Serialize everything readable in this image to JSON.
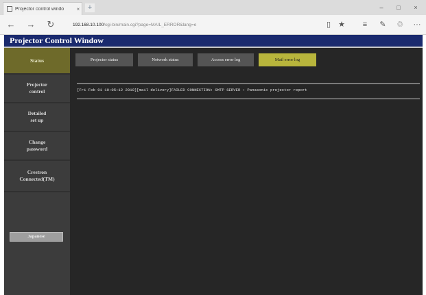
{
  "browser": {
    "tab_title": "Projector control windo",
    "tab_close": "×",
    "new_tab": "+",
    "window_controls": {
      "minimize": "–",
      "maximize": "□",
      "close": "×"
    },
    "nav": {
      "back": "←",
      "forward": "→",
      "refresh": "↻"
    },
    "url_host": "192.168.10.100",
    "url_path": "/cgi-bin/main.cgi?page=MAIL_ERROR&lang=e",
    "toolbar_icons": [
      "reading-view-icon",
      "favorite-star-icon",
      "hub-icon",
      "web-note-icon",
      "share-icon",
      "more-icon"
    ],
    "toolbar_glyphs": {
      "reading": "▯",
      "favorite": "★",
      "hub": "≡",
      "note": "✎",
      "share": "♲",
      "more": "···"
    }
  },
  "app": {
    "title": "Projector Control Window",
    "accent_colors": {
      "title_bar": "#1a2a6e",
      "active_side": "#6e6a2a",
      "active_tab": "#b8b53c"
    }
  },
  "sidebar": {
    "items": [
      {
        "label": "Status",
        "active": true
      },
      {
        "label": "Projector\ncontrol",
        "active": false
      },
      {
        "label": "Detailed\nset up",
        "active": false
      },
      {
        "label": "Change\npassword",
        "active": false
      },
      {
        "label": "Crestron\nConnected(TM)",
        "active": false
      }
    ],
    "button_label": "Japanese"
  },
  "tabs": [
    {
      "label": "Projector status",
      "active": false
    },
    {
      "label": "Network status",
      "active": false
    },
    {
      "label": "Access error log",
      "active": false
    },
    {
      "label": "Mail error log",
      "active": true
    }
  ],
  "log": {
    "entries": [
      "[Fri Feb 01 10:05:12 2019][mail delivery]FAILED CONNECTION: SMTP SERVER : Panasonic projector report"
    ]
  }
}
